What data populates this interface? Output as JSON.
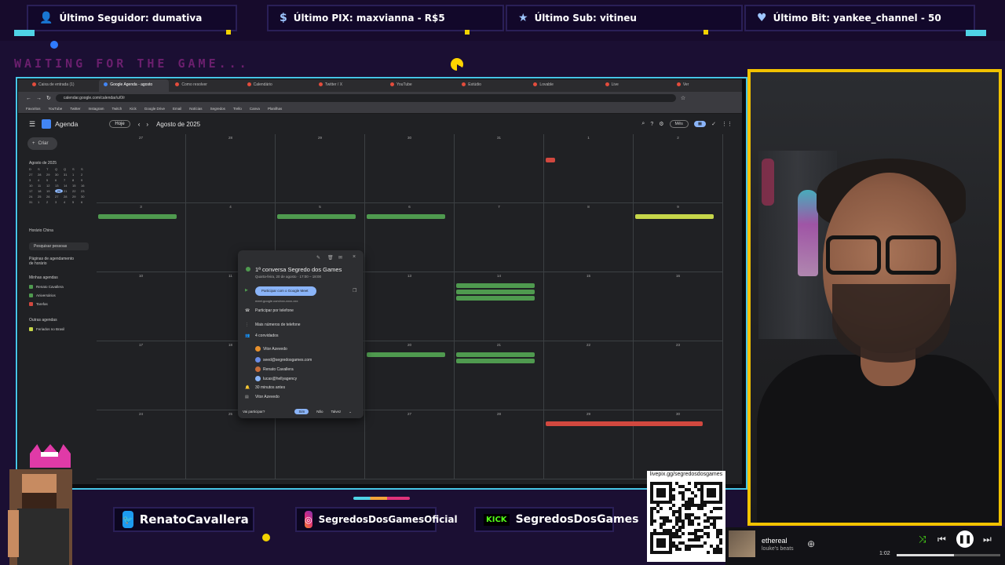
{
  "overlay": {
    "alerts": [
      {
        "icon": "user-icon",
        "label": "Último Seguidor: dumativa"
      },
      {
        "icon": "pix-icon",
        "label": "Último PIX: maxvianna - R$5"
      },
      {
        "icon": "star-icon",
        "label": "Último Sub: vitineu"
      },
      {
        "icon": "heart-icon",
        "label": "Último Bit: yankee_channel - 50"
      }
    ],
    "waiting_text": "WAITING FOR THE GAME...",
    "socials": {
      "twitter": "RenatoCavallera",
      "instagram": "SegredosDosGamesOficial",
      "kick": "SegredosDosGames",
      "kick_badge": "KICK"
    },
    "qr_url": "livepix.gg/segredosdosgames"
  },
  "player": {
    "track": "ethereal",
    "artist": "louke's beats",
    "time": "1:02",
    "progress": 0.55
  },
  "browser": {
    "tabs": [
      "Caixa de entrada (1)",
      "Google Agenda - agosto",
      "Como resolver",
      "Calendário",
      "Twitter / X",
      "YouTube",
      "Estúdio",
      "Lovable",
      "Live",
      "Ver"
    ],
    "url": "calendar.google.com/calendar/u/0/r",
    "bookmarks": [
      "Favoritos",
      "YouTube",
      "Twitter",
      "Instagram",
      "Twitch",
      "Kick",
      "Google Drive",
      "Email",
      "Notícias",
      "Segredos",
      "Trello",
      "Canva",
      "Planilhas"
    ]
  },
  "calendar": {
    "app_name": "Agenda",
    "today_button": "Hoje",
    "month_title": "Agosto de 2025",
    "view_button": "Mês",
    "create_button": "Criar",
    "mini_month_title": "Agosto de 2025",
    "mini_days": [
      "27",
      "28",
      "29",
      "30",
      "31",
      "1",
      "2",
      "3",
      "4",
      "5",
      "6",
      "7",
      "8",
      "9",
      "10",
      "11",
      "12",
      "13",
      "14",
      "15",
      "16",
      "17",
      "18",
      "19",
      "20",
      "21",
      "22",
      "23",
      "24",
      "25",
      "26",
      "27",
      "28",
      "29",
      "30",
      "31",
      "1",
      "2",
      "3",
      "4",
      "5",
      "6"
    ],
    "timezone": "Horário China",
    "search_people": "Pesquisar pessoas",
    "booking_pages": "Páginas de agendamento de horário",
    "my_calendars": "Minhas agendas",
    "calendars": [
      {
        "name": "Renato Cavallera",
        "color": "#4f9a4f"
      },
      {
        "name": "Aniversários",
        "color": "#4f9a4f"
      },
      {
        "name": "Tarefas",
        "color": "#d2483f"
      }
    ],
    "other_calendars": "Outras agendas",
    "other_items": [
      {
        "name": "Feriados no Brasil",
        "color": "#c6d64a"
      }
    ],
    "weeks": [
      [
        "27",
        "28",
        "29",
        "30",
        "31",
        "1",
        "2"
      ],
      [
        "3",
        "4",
        "5",
        "6",
        "7",
        "8",
        "9"
      ],
      [
        "10",
        "11",
        "12",
        "13",
        "14",
        "15",
        "16"
      ],
      [
        "17",
        "18",
        "19",
        "20",
        "21",
        "22",
        "23"
      ],
      [
        "24",
        "25",
        "26",
        "27",
        "28",
        "29",
        "30"
      ]
    ],
    "popup": {
      "title": "1ª conversa Segredo dos Games",
      "date": "Quarta-feira, 20 de agosto · 17:00 – 18:00",
      "meet_button": "Participar com o Google Meet",
      "meet_link": "meet.google.com/xxx-xxxx-xxx",
      "phone": "Participar por telefone",
      "more_phones": "Mais números de telefone",
      "guests_header": "4 convidados",
      "guests": [
        "Vitor Azevedo",
        "seed@segredosgames.com",
        "Renato Cavallera",
        "lucas@hellyagency"
      ],
      "reminder": "30 minutos antes",
      "organizer": "Vitor Azevedo",
      "rsvp_question": "Vai participar?",
      "yes": "Sim",
      "no": "Não",
      "maybe": "Talvez"
    }
  }
}
